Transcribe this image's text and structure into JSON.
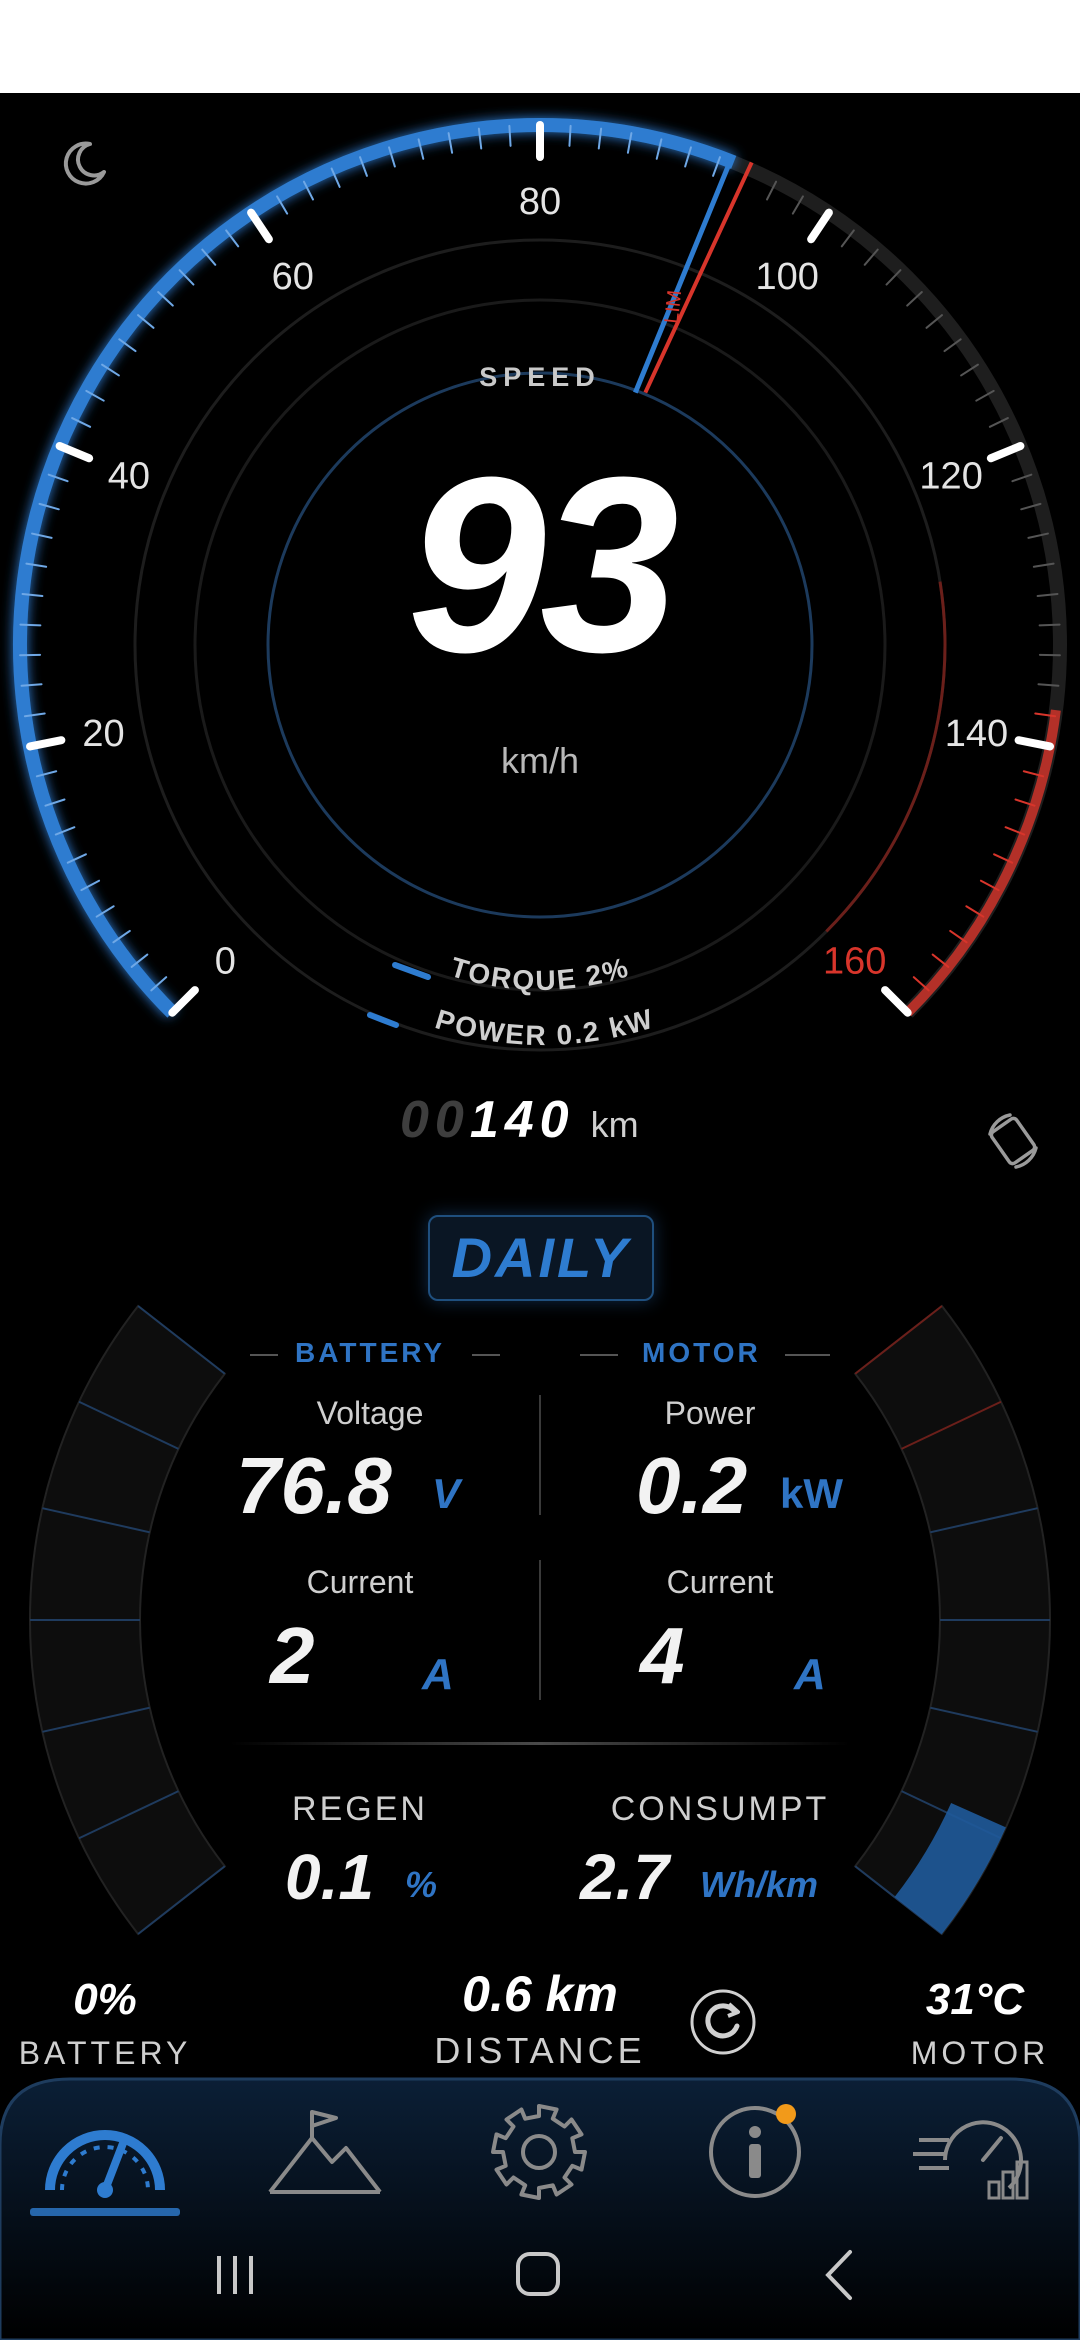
{
  "gauge": {
    "ticks": [
      "0",
      "20",
      "40",
      "60",
      "80",
      "100",
      "120",
      "140",
      "160"
    ],
    "speed_label": "SPEED",
    "speed_value": "93",
    "speed_unit": "km/h",
    "torque": "TORQUE 2%",
    "power": "POWER 0.2 kW",
    "lim": "LIM",
    "speed_fraction": 0.581,
    "colors": {
      "accent": "#2e7cd0",
      "warning": "#d8352b"
    }
  },
  "odometer": {
    "dim_digits": "00",
    "digits": "140",
    "unit": "km"
  },
  "mode_button": "DAILY",
  "battery": {
    "title": "BATTERY",
    "voltage_label": "Voltage",
    "voltage_value": "76.8",
    "voltage_unit": "V",
    "current_label": "Current",
    "current_value": "2",
    "current_unit": "A"
  },
  "motor": {
    "title": "MOTOR",
    "power_label": "Power",
    "power_value": "0.2",
    "power_unit": "kW",
    "current_label": "Current",
    "current_value": "4",
    "current_unit": "A"
  },
  "regen": {
    "label": "REGEN",
    "value": "0.1",
    "unit": "%"
  },
  "consumption": {
    "label": "CONSUMPT",
    "value": "2.7",
    "unit": "Wh/km"
  },
  "footer": {
    "battery_value": "0%",
    "battery_label": "BATTERY",
    "distance_value": "0.6 km",
    "distance_label": "DISTANCE",
    "motor_value": "31°C",
    "motor_label": "MOTOR"
  },
  "nav": [
    "speedometer-icon",
    "mountain-flag-icon",
    "gear-icon",
    "info-icon",
    "performance-icon"
  ]
}
